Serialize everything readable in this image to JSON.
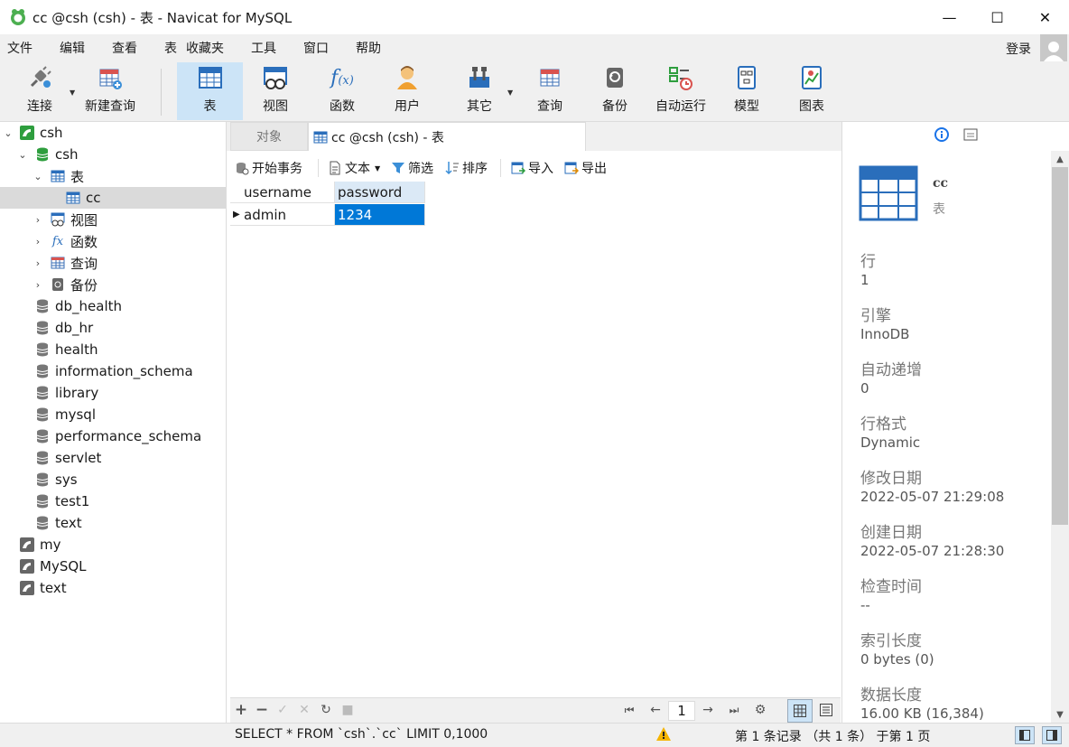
{
  "window": {
    "title": "cc @csh (csh) - 表 - Navicat for MySQL"
  },
  "menu": {
    "items": [
      "文件",
      "编辑",
      "查看",
      "表",
      "收藏夹",
      "工具",
      "窗口",
      "帮助"
    ],
    "login": "登录"
  },
  "toolbar": {
    "connect": "连接",
    "new_query": "新建查询",
    "table": "表",
    "view": "视图",
    "function": "函数",
    "user": "用户",
    "other": "其它",
    "query": "查询",
    "backup": "备份",
    "auto_run": "自动运行",
    "model": "模型",
    "chart": "图表"
  },
  "navigator": {
    "connection": "csh",
    "database": "csh",
    "tables_group": "表",
    "table_cc": "cc",
    "views_group": "视图",
    "functions_group": "函数",
    "queries_group": "查询",
    "backups_group": "备份",
    "databases": [
      "db_health",
      "db_hr",
      "health",
      "information_schema",
      "library",
      "mysql",
      "performance_schema",
      "servlet",
      "sys",
      "test1",
      "text"
    ],
    "connections": [
      "my",
      "MySQL",
      "text"
    ]
  },
  "tabs": {
    "objects": "对象",
    "active": "cc @csh (csh) - 表"
  },
  "object_toolbar": {
    "begin_transaction": "开始事务",
    "text": "文本",
    "filter": "筛选",
    "sort": "排序",
    "import": "导入",
    "export": "导出"
  },
  "grid": {
    "columns": [
      "username",
      "password"
    ],
    "rows": [
      [
        "admin",
        "1234"
      ]
    ]
  },
  "grid_footer": {
    "page": "1"
  },
  "info": {
    "name": "cc",
    "type": "表",
    "fields": [
      {
        "label": "行",
        "value": "1"
      },
      {
        "label": "引擎",
        "value": "InnoDB"
      },
      {
        "label": "自动递增",
        "value": "0"
      },
      {
        "label": "行格式",
        "value": "Dynamic"
      },
      {
        "label": "修改日期",
        "value": "2022-05-07 21:29:08"
      },
      {
        "label": "创建日期",
        "value": "2022-05-07 21:28:30"
      },
      {
        "label": "检查时间",
        "value": "--"
      },
      {
        "label": "索引长度",
        "value": "0 bytes (0)"
      },
      {
        "label": "数据长度",
        "value": "16.00 KB (16,384)"
      }
    ]
  },
  "status": {
    "sql": "SELECT * FROM `csh`.`cc` LIMIT 0,1000",
    "records": "第 1 条记录 （共 1 条） 于第 1 页"
  },
  "colors": {
    "accent": "#0078d7",
    "selected_toolbar": "#cce4f7",
    "db_green": "#2e9e3e"
  }
}
